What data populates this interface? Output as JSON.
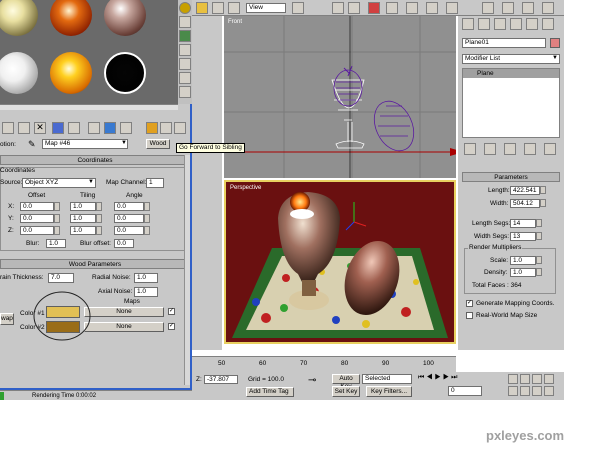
{
  "material_editor": {
    "toolbar_label": "otion:",
    "map_name": "Map #46",
    "map_type": "Wood",
    "tooltip": "Go Forward to Sibling",
    "coordinates": {
      "title": "Coordinates",
      "group": "Coordinates",
      "source_label": "Source:",
      "source_value": "Object XYZ",
      "channel_label": "Map Channel:",
      "channel_value": "1",
      "col_offset": "Offset",
      "col_tiling": "Tiling",
      "col_angle": "Angle",
      "rows": [
        {
          "axis": "X:",
          "offset": "0.0",
          "tiling": "1.0",
          "angle": "0.0"
        },
        {
          "axis": "Y:",
          "offset": "0.0",
          "tiling": "1.0",
          "angle": "0.0"
        },
        {
          "axis": "Z:",
          "offset": "0.0",
          "tiling": "1.0",
          "angle": "0.0"
        }
      ],
      "blur_label": "Blur:",
      "blur_value": "1.0",
      "blur_offset_label": "Blur offset:",
      "blur_offset_value": "0.0"
    },
    "wood": {
      "title": "Wood Parameters",
      "grain_label": "rain Thickness:",
      "grain_value": "7.0",
      "radial_label": "Radial Noise:",
      "radial_value": "1.0",
      "axial_label": "Axial Noise:",
      "axial_value": "1.0",
      "maps_label": "Maps",
      "swap_label": "wap",
      "color1_label": "Color #1",
      "color2_label": "Color #2",
      "none1": "None",
      "none2": "None",
      "color1": "#e2c055",
      "color2": "#9a6d18"
    }
  },
  "viewports": {
    "top_label": "Front",
    "persp_label": "Perspective",
    "view_dropdown": "View"
  },
  "command_panel": {
    "object_name": "Plane01",
    "modifier_list": "Modifier List",
    "stack_item": "Plane",
    "params_title": "Parameters",
    "length_label": "Length:",
    "length_value": "422.541",
    "width_label": "Width:",
    "width_value": "504.12",
    "length_segs_label": "Length Segs:",
    "length_segs_value": "14",
    "width_segs_label": "Width Segs:",
    "width_segs_value": "13",
    "render_mult": "Render Multipliers",
    "scale_label": "Scale:",
    "scale_value": "1.0",
    "density_label": "Density:",
    "density_value": "1.0",
    "total_faces": "Total Faces : 364",
    "gen_coords": "Generate Mapping Coords.",
    "real_world": "Real-World Map Size"
  },
  "timeline": {
    "ticks": [
      "50",
      "60",
      "70",
      "80",
      "90",
      "100"
    ]
  },
  "status": {
    "z_label": "Z:",
    "z_value": "-37.807",
    "grid": "Grid = 100.0",
    "auto_key": "Auto Key",
    "selected": "Selected",
    "set_key": "Set Key",
    "key_filters": "Key Filters...",
    "add_time_tag": "Add Time Tag",
    "frame": "0",
    "render_time": "Rendering Time  0:00:02"
  },
  "watermark": "pxleyes.com"
}
